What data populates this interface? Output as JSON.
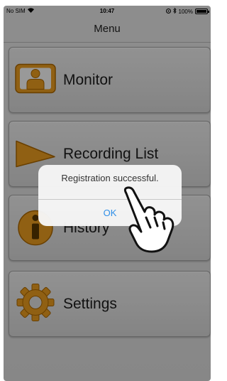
{
  "status_bar": {
    "carrier": "No SIM",
    "time": "10:47",
    "battery": "100%"
  },
  "nav": {
    "title": "Menu"
  },
  "menu": {
    "items": [
      {
        "label": "Monitor",
        "icon": "person-monitor-icon"
      },
      {
        "label": "Recording List",
        "icon": "play-triangle-icon"
      },
      {
        "label": "History",
        "icon": "info-icon"
      },
      {
        "label": "Settings",
        "icon": "gear-icon"
      }
    ]
  },
  "alert": {
    "message": "Registration successful.",
    "ok_label": "OK"
  },
  "colors": {
    "accent": "#2f8fe8",
    "icon_orange": "#f0a020",
    "icon_dark": "#5a3a00"
  }
}
